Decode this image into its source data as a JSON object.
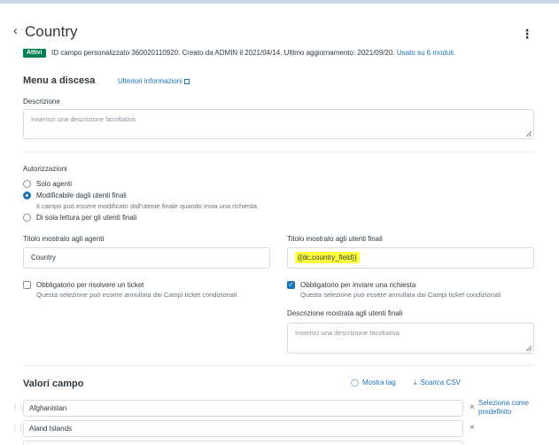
{
  "header": {
    "title": "Country",
    "status_badge": "Attivi",
    "meta_text": "ID campo personalizzato 360020110920. Creato da ADMIN il 2021/04/14. Ultimo aggiornamento: 2021/09/20.",
    "usage_link": "Usato su 6 moduli."
  },
  "dropdown_section": {
    "title": "Menu a discesa",
    "info_link": "Ulteriori informazioni",
    "description_label": "Descrizione",
    "description_placeholder": "Inserisci una descrizione facoltativa"
  },
  "permissions": {
    "label": "Autorizzazioni",
    "options": [
      {
        "label": "Solo agenti",
        "checked": false
      },
      {
        "label": "Modificabile dagli utenti finali",
        "checked": true,
        "hint": "Il campo può essere modificato dall'utente finale quando invia una richiesta."
      },
      {
        "label": "Di sola lettura per gli utenti finali",
        "checked": false
      }
    ]
  },
  "agent_title": {
    "label": "Titolo mostrato agli agenti",
    "value": "Country"
  },
  "enduser_title": {
    "label": "Titolo mostrato agli utenti finali",
    "value": "{{dc.country_field}}"
  },
  "required_solve": {
    "label": "Obbligatorio per risolvere un ticket",
    "hint": "Questa selezione può essere annullata dai Campi ticket condizionali",
    "checked": false
  },
  "required_submit": {
    "label": "Obbligatorio per inviare una richiesta",
    "hint": "Questa selezione può essere annullata dai Campi ticket condizionali",
    "checked": true
  },
  "enduser_description": {
    "label": "Descrizione mostrata agli utenti finali",
    "placeholder": "Inserisci una descrizione facoltativa"
  },
  "field_values": {
    "title": "Valori campo",
    "show_tags": "Mostra tag",
    "download_csv": "Scarica CSV",
    "set_default": "Seleziona come predefinito",
    "items": [
      "Afghanistan",
      "Aland Islands"
    ]
  },
  "icons": {
    "back": "chevron-left-icon",
    "more": "kebab-icon",
    "external": "external-link-icon",
    "tag": "tag-icon",
    "download": "download-icon",
    "drag": "drag-handle-icon",
    "remove": "close-icon"
  },
  "colors": {
    "accent": "#1f73b7",
    "active_badge": "#038153",
    "highlight": "#ffff3c"
  }
}
